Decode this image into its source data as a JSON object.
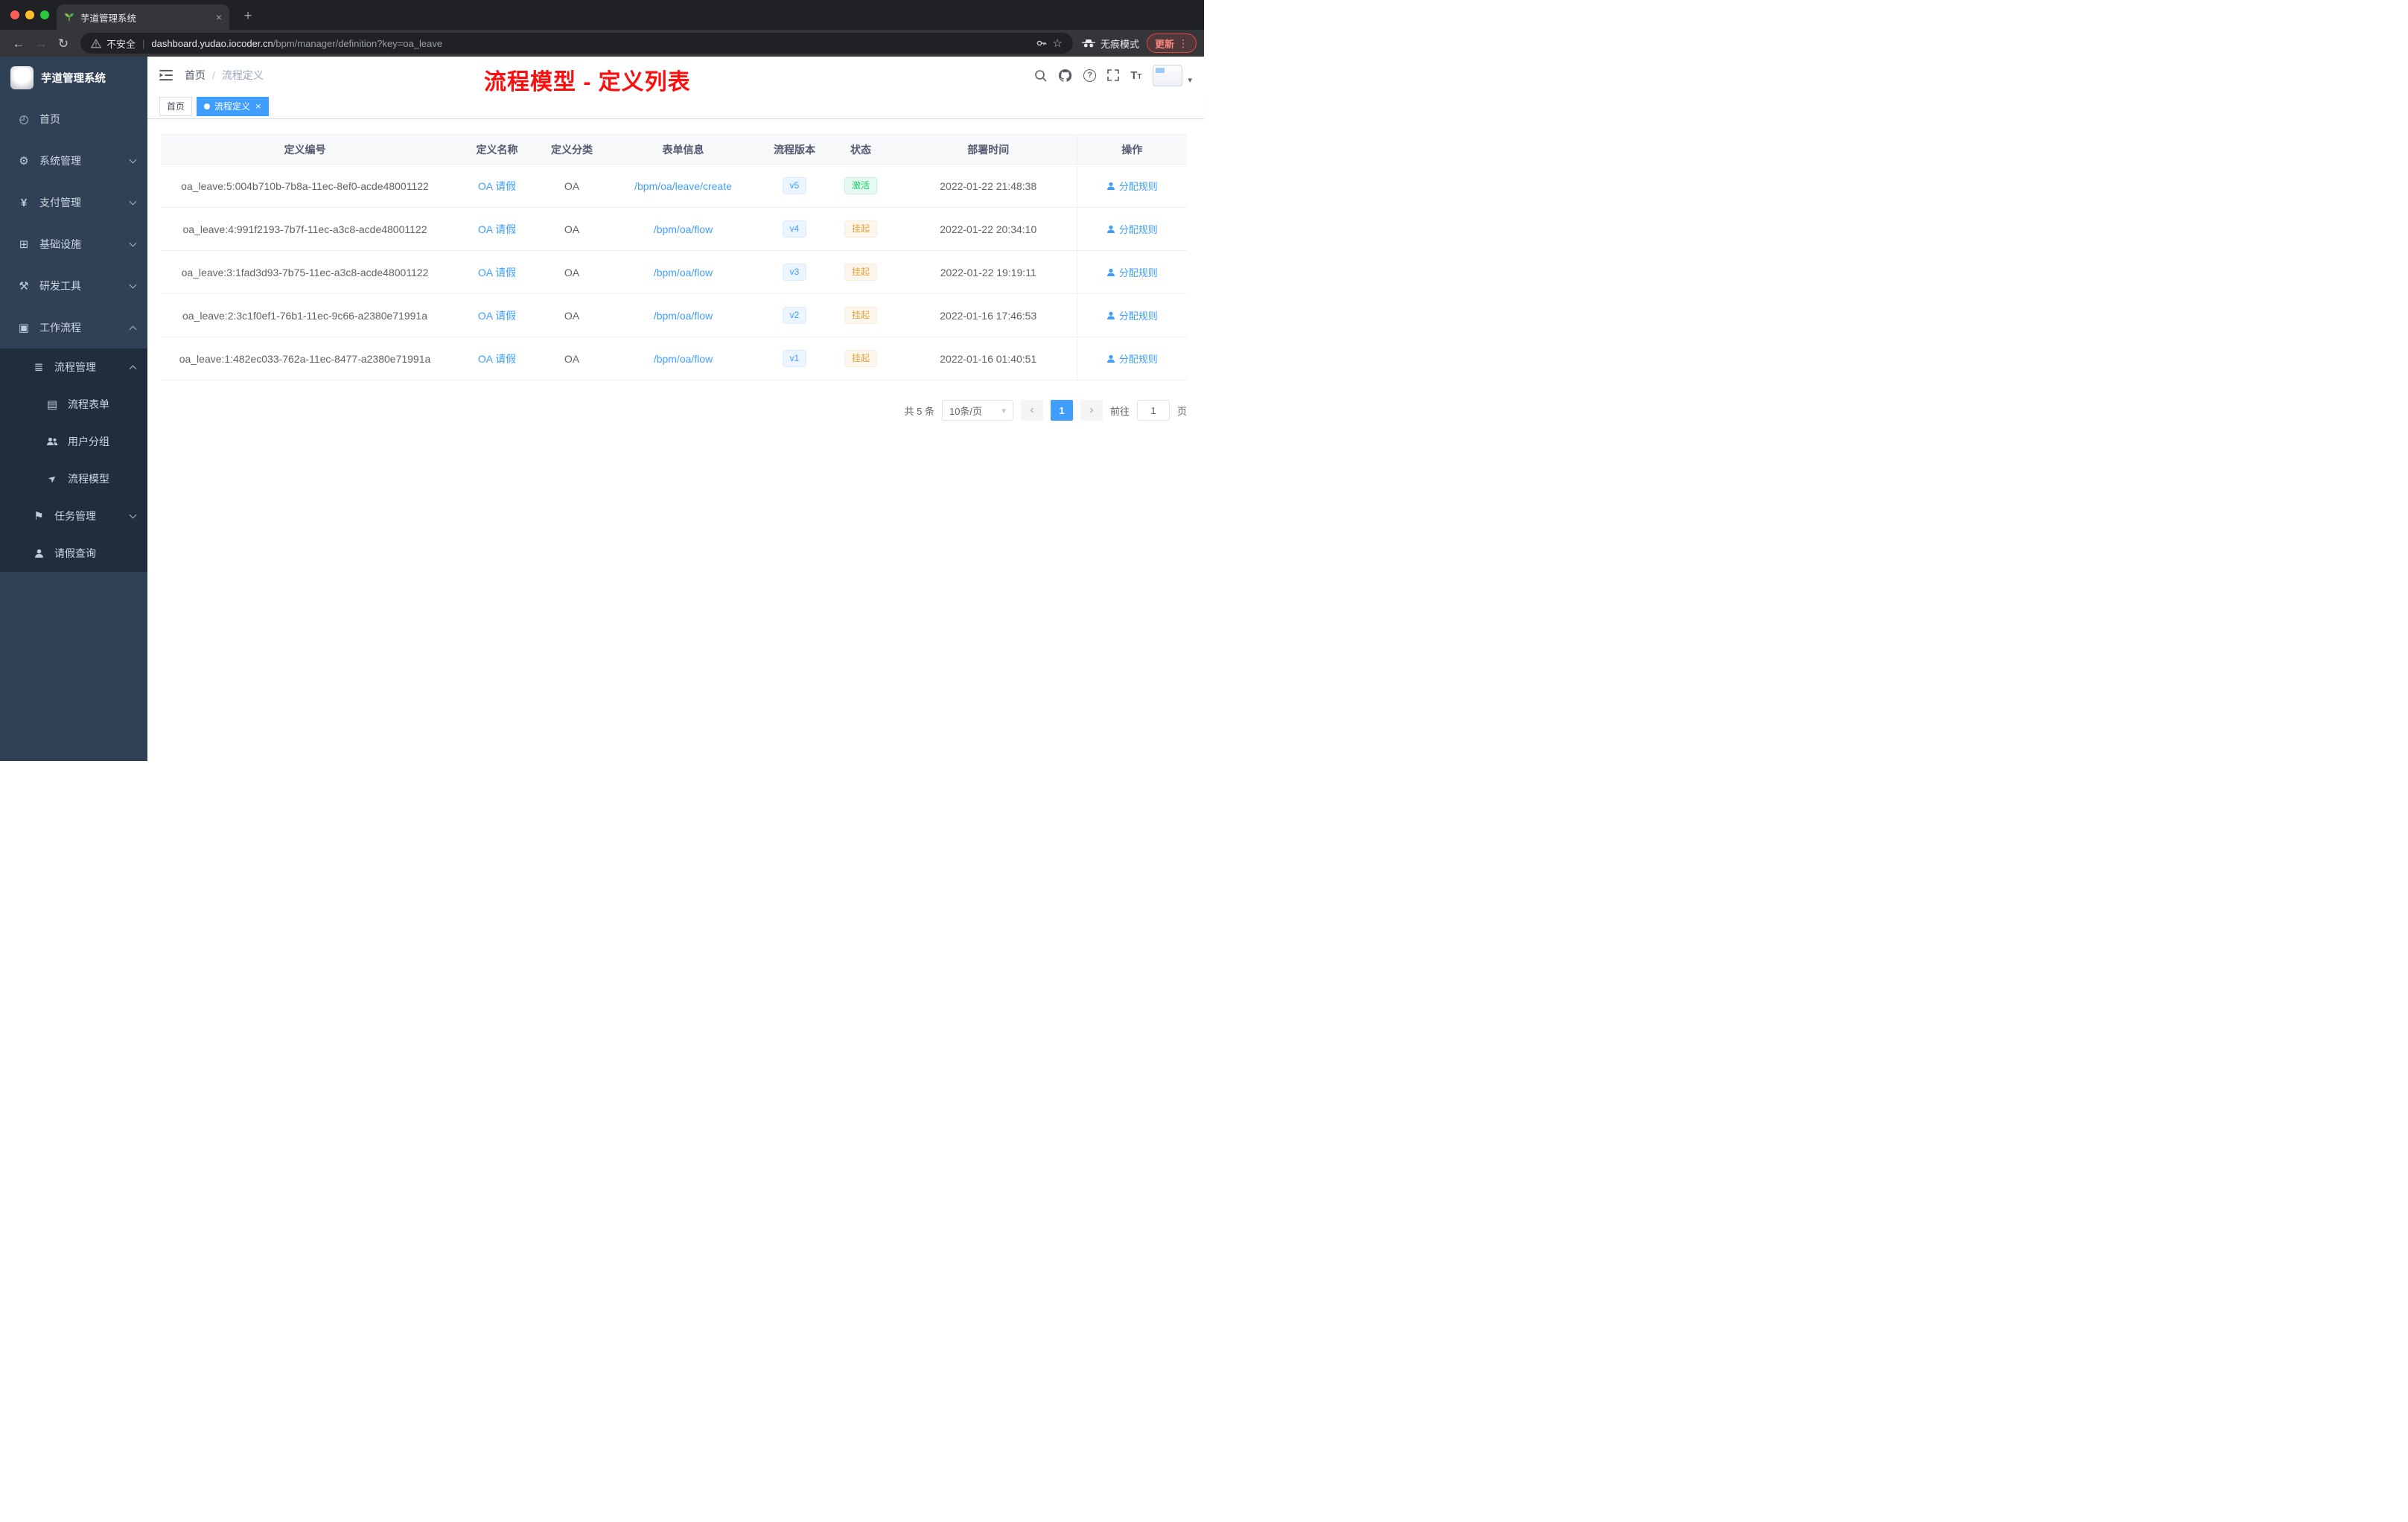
{
  "browser": {
    "tab_title": "芋道管理系统",
    "security_label": "不安全",
    "url_host": "dashboard.yudao.iocoder.cn",
    "url_path": "/bpm/manager/definition?key=oa_leave",
    "incognito_label": "无痕模式",
    "update_label": "更新"
  },
  "sidebar": {
    "app_title": "芋道管理系统",
    "items": [
      {
        "label": "首页",
        "icon": "dashboard-icon"
      },
      {
        "label": "系统管理",
        "icon": "gear-icon"
      },
      {
        "label": "支付管理",
        "icon": "yen-icon"
      },
      {
        "label": "基础设施",
        "icon": "grid-icon"
      },
      {
        "label": "研发工具",
        "icon": "tools-icon"
      },
      {
        "label": "工作流程",
        "icon": "workflow-icon"
      },
      {
        "label": "流程管理",
        "icon": "list-icon"
      },
      {
        "label": "流程表单",
        "icon": "form-icon"
      },
      {
        "label": "用户分组",
        "icon": "users-icon"
      },
      {
        "label": "流程模型",
        "icon": "send-icon"
      },
      {
        "label": "任务管理",
        "icon": "flag-icon"
      },
      {
        "label": "请假查询",
        "icon": "user-icon"
      }
    ]
  },
  "header": {
    "breadcrumb_home": "首页",
    "breadcrumb_current": "流程定义",
    "annotation": "流程模型 - 定义列表"
  },
  "tags": {
    "home": "首页",
    "current": "流程定义"
  },
  "table": {
    "columns": [
      "定义编号",
      "定义名称",
      "定义分类",
      "表单信息",
      "流程版本",
      "状态",
      "部署时间",
      "操作"
    ],
    "rows": [
      {
        "id": "oa_leave:5:004b710b-7b8a-11ec-8ef0-acde48001122",
        "name": "OA 请假",
        "category": "OA",
        "form": "/bpm/oa/leave/create",
        "version": "v5",
        "status": "激活",
        "time": "2022-01-22 21:48:38",
        "action": "分配规则"
      },
      {
        "id": "oa_leave:4:991f2193-7b7f-11ec-a3c8-acde48001122",
        "name": "OA 请假",
        "category": "OA",
        "form": "/bpm/oa/flow",
        "version": "v4",
        "status": "挂起",
        "time": "2022-01-22 20:34:10",
        "action": "分配规则"
      },
      {
        "id": "oa_leave:3:1fad3d93-7b75-11ec-a3c8-acde48001122",
        "name": "OA 请假",
        "category": "OA",
        "form": "/bpm/oa/flow",
        "version": "v3",
        "status": "挂起",
        "time": "2022-01-22 19:19:11",
        "action": "分配规则"
      },
      {
        "id": "oa_leave:2:3c1f0ef1-76b1-11ec-9c66-a2380e71991a",
        "name": "OA 请假",
        "category": "OA",
        "form": "/bpm/oa/flow",
        "version": "v2",
        "status": "挂起",
        "time": "2022-01-16 17:46:53",
        "action": "分配规则"
      },
      {
        "id": "oa_leave:1:482ec033-762a-11ec-8477-a2380e71991a",
        "name": "OA 请假",
        "category": "OA",
        "form": "/bpm/oa/flow",
        "version": "v1",
        "status": "挂起",
        "time": "2022-01-16 01:40:51",
        "action": "分配规则"
      }
    ]
  },
  "pagination": {
    "total": "共 5 条",
    "page_size": "10条/页",
    "page": "1",
    "goto_label": "前往",
    "goto_value": "1",
    "unit_label": "页"
  },
  "colors": {
    "accent": "#409eff",
    "sidebar_bg": "#304156",
    "submenu_bg": "#1f2d3d",
    "success": "#13ce66",
    "warning": "#e6a23c",
    "annotation_red": "#fb0e0e",
    "active_tag": "#409eff"
  }
}
